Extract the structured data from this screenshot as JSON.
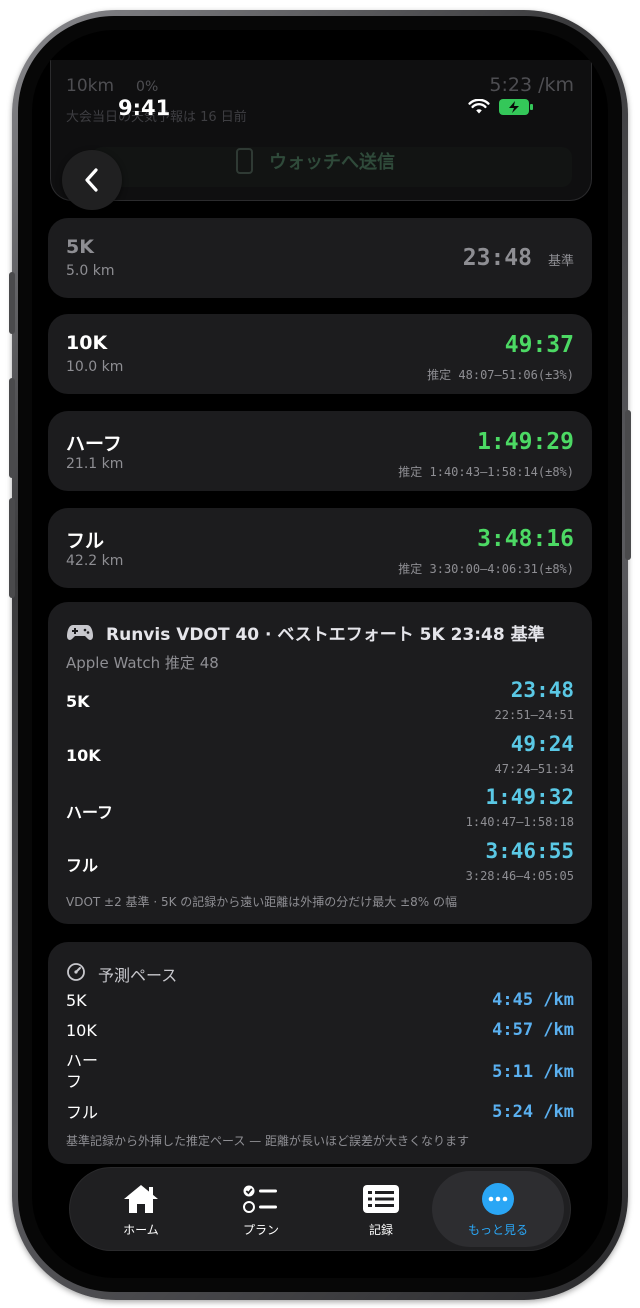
{
  "status": {
    "time": "9:41"
  },
  "peek": {
    "distance": "10km",
    "percent": "0%",
    "pace": "5:23 /km",
    "notice": "大会当日の天気予報は 16 日前",
    "watch_button": "ウォッチへ送信"
  },
  "predictions": [
    {
      "name": "5K",
      "distance": "5.0 km",
      "time": "23:48",
      "note": "基準",
      "range": ""
    },
    {
      "name": "10K",
      "distance": "10.0 km",
      "time": "49:37",
      "note": "",
      "range": "推定 48:07–51:06(±3%)"
    },
    {
      "name": "ハーフ",
      "distance": "21.1 km",
      "time": "1:49:29",
      "note": "",
      "range": "推定 1:40:43–1:58:14(±8%)"
    },
    {
      "name": "フル",
      "distance": "42.2 km",
      "time": "3:48:16",
      "note": "",
      "range": "推定 3:30:00–4:06:31(±8%)"
    }
  ],
  "vdot": {
    "title": "Runvis VDOT 40 · ベストエフォート 5K 23:48 基準",
    "subtitle": "Apple Watch 推定 48",
    "rows": [
      {
        "label": "5K",
        "time": "23:48",
        "range": "22:51–24:51"
      },
      {
        "label": "10K",
        "time": "49:24",
        "range": "47:24–51:34"
      },
      {
        "label": "ハーフ",
        "time": "1:49:32",
        "range": "1:40:47–1:58:18"
      },
      {
        "label": "フル",
        "time": "3:46:55",
        "range": "3:28:46–4:05:05"
      }
    ],
    "note": "VDOT ±2 基準 · 5K の記録から遠い距離は外挿の分だけ最大 ±8% の幅"
  },
  "pace": {
    "title": "予測ペース",
    "rows": [
      {
        "label": "5K",
        "value": "4:45 /km"
      },
      {
        "label": "10K",
        "value": "4:57 /km"
      },
      {
        "label": "ハーフ",
        "value": "5:11 /km"
      },
      {
        "label": "フル",
        "value": "5:24 /km"
      }
    ],
    "note": "基準記録から外挿した推定ペース — 距離が長いほど誤差が大きくなります"
  },
  "tabs": [
    {
      "label": "ホーム",
      "icon": "house-icon"
    },
    {
      "label": "プラン",
      "icon": "checklist-icon"
    },
    {
      "label": "記録",
      "icon": "list-icon"
    },
    {
      "label": "もっと見る",
      "icon": "ellipsis-icon",
      "active": true
    }
  ],
  "colors": {
    "accent_green": "#4cd964",
    "accent_cyan": "#5ac8e5",
    "accent_blue": "#2aa6f5",
    "card": "#1c1c1e"
  }
}
